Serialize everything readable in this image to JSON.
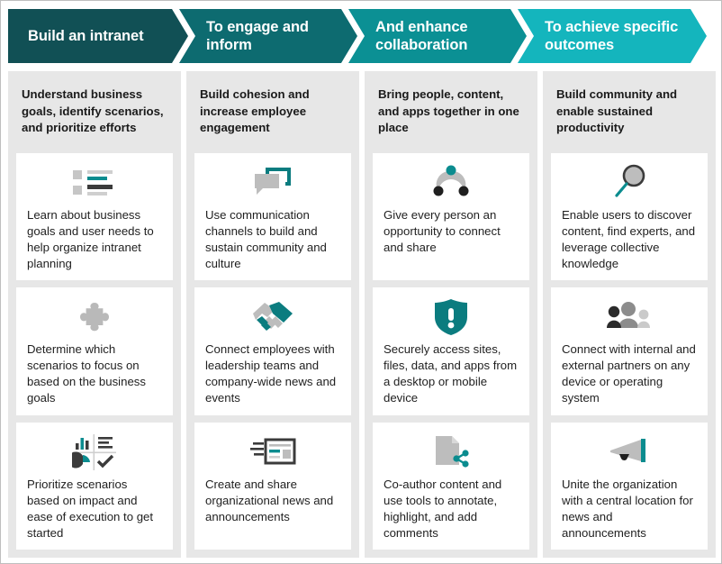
{
  "colors": {
    "chevron_1": "#115055",
    "chevron_2": "#0d6b70",
    "chevron_3": "#0b9094",
    "chevron_4": "#14b5bd",
    "panel_bg": "#e7e7e7",
    "card_bg": "#ffffff",
    "teal_accent": "#0b7c7f",
    "gray_icon": "#bdbdbd",
    "dark_icon": "#3b3b3b",
    "text": "#1f1f1f",
    "page_border": "#bfbfbf"
  },
  "columns": [
    {
      "header": "Build an intranet",
      "description": "Understand business goals, identify scenarios, and prioritize efforts",
      "cards": [
        {
          "icon": "list-view-icon",
          "text": "Learn about business goals and user needs to help organize intranet planning"
        },
        {
          "icon": "puzzle-piece-icon",
          "text": "Determine which scenarios to focus on based on the business goals"
        },
        {
          "icon": "analytics-dashboard-icon",
          "text": "Prioritize scenarios based on impact and ease of execution to get started"
        }
      ]
    },
    {
      "header": "To engage and inform",
      "description": "Build cohesion and increase employee engagement",
      "cards": [
        {
          "icon": "chat-bubbles-icon",
          "text": "Use communication channels to build and sustain community and culture"
        },
        {
          "icon": "handshake-icon",
          "text": "Connect employees with leadership teams and company-wide news and events"
        },
        {
          "icon": "news-article-icon",
          "text": "Create and share organizational news and announcements"
        }
      ]
    },
    {
      "header": "And enhance collaboration",
      "description": "Bring people, content, and apps together in one place",
      "cards": [
        {
          "icon": "share-network-icon",
          "text": "Give every person an opportunity to connect and share"
        },
        {
          "icon": "shield-alert-icon",
          "text": "Securely access sites, files, data, and apps from a desktop or mobile device"
        },
        {
          "icon": "document-share-icon",
          "text": "Co-author content and use tools to annotate, highlight, and add comments"
        }
      ]
    },
    {
      "header": "To achieve specific outcomes",
      "description": "Build community and enable sustained productivity",
      "cards": [
        {
          "icon": "magnifying-glass-icon",
          "text": "Enable users to discover content, find experts, and leverage collective knowledge"
        },
        {
          "icon": "people-group-icon",
          "text": "Connect with internal and external partners on any device or operating system"
        },
        {
          "icon": "megaphone-icon",
          "text": "Unite the organization with a central location for news and announcements"
        }
      ]
    }
  ]
}
